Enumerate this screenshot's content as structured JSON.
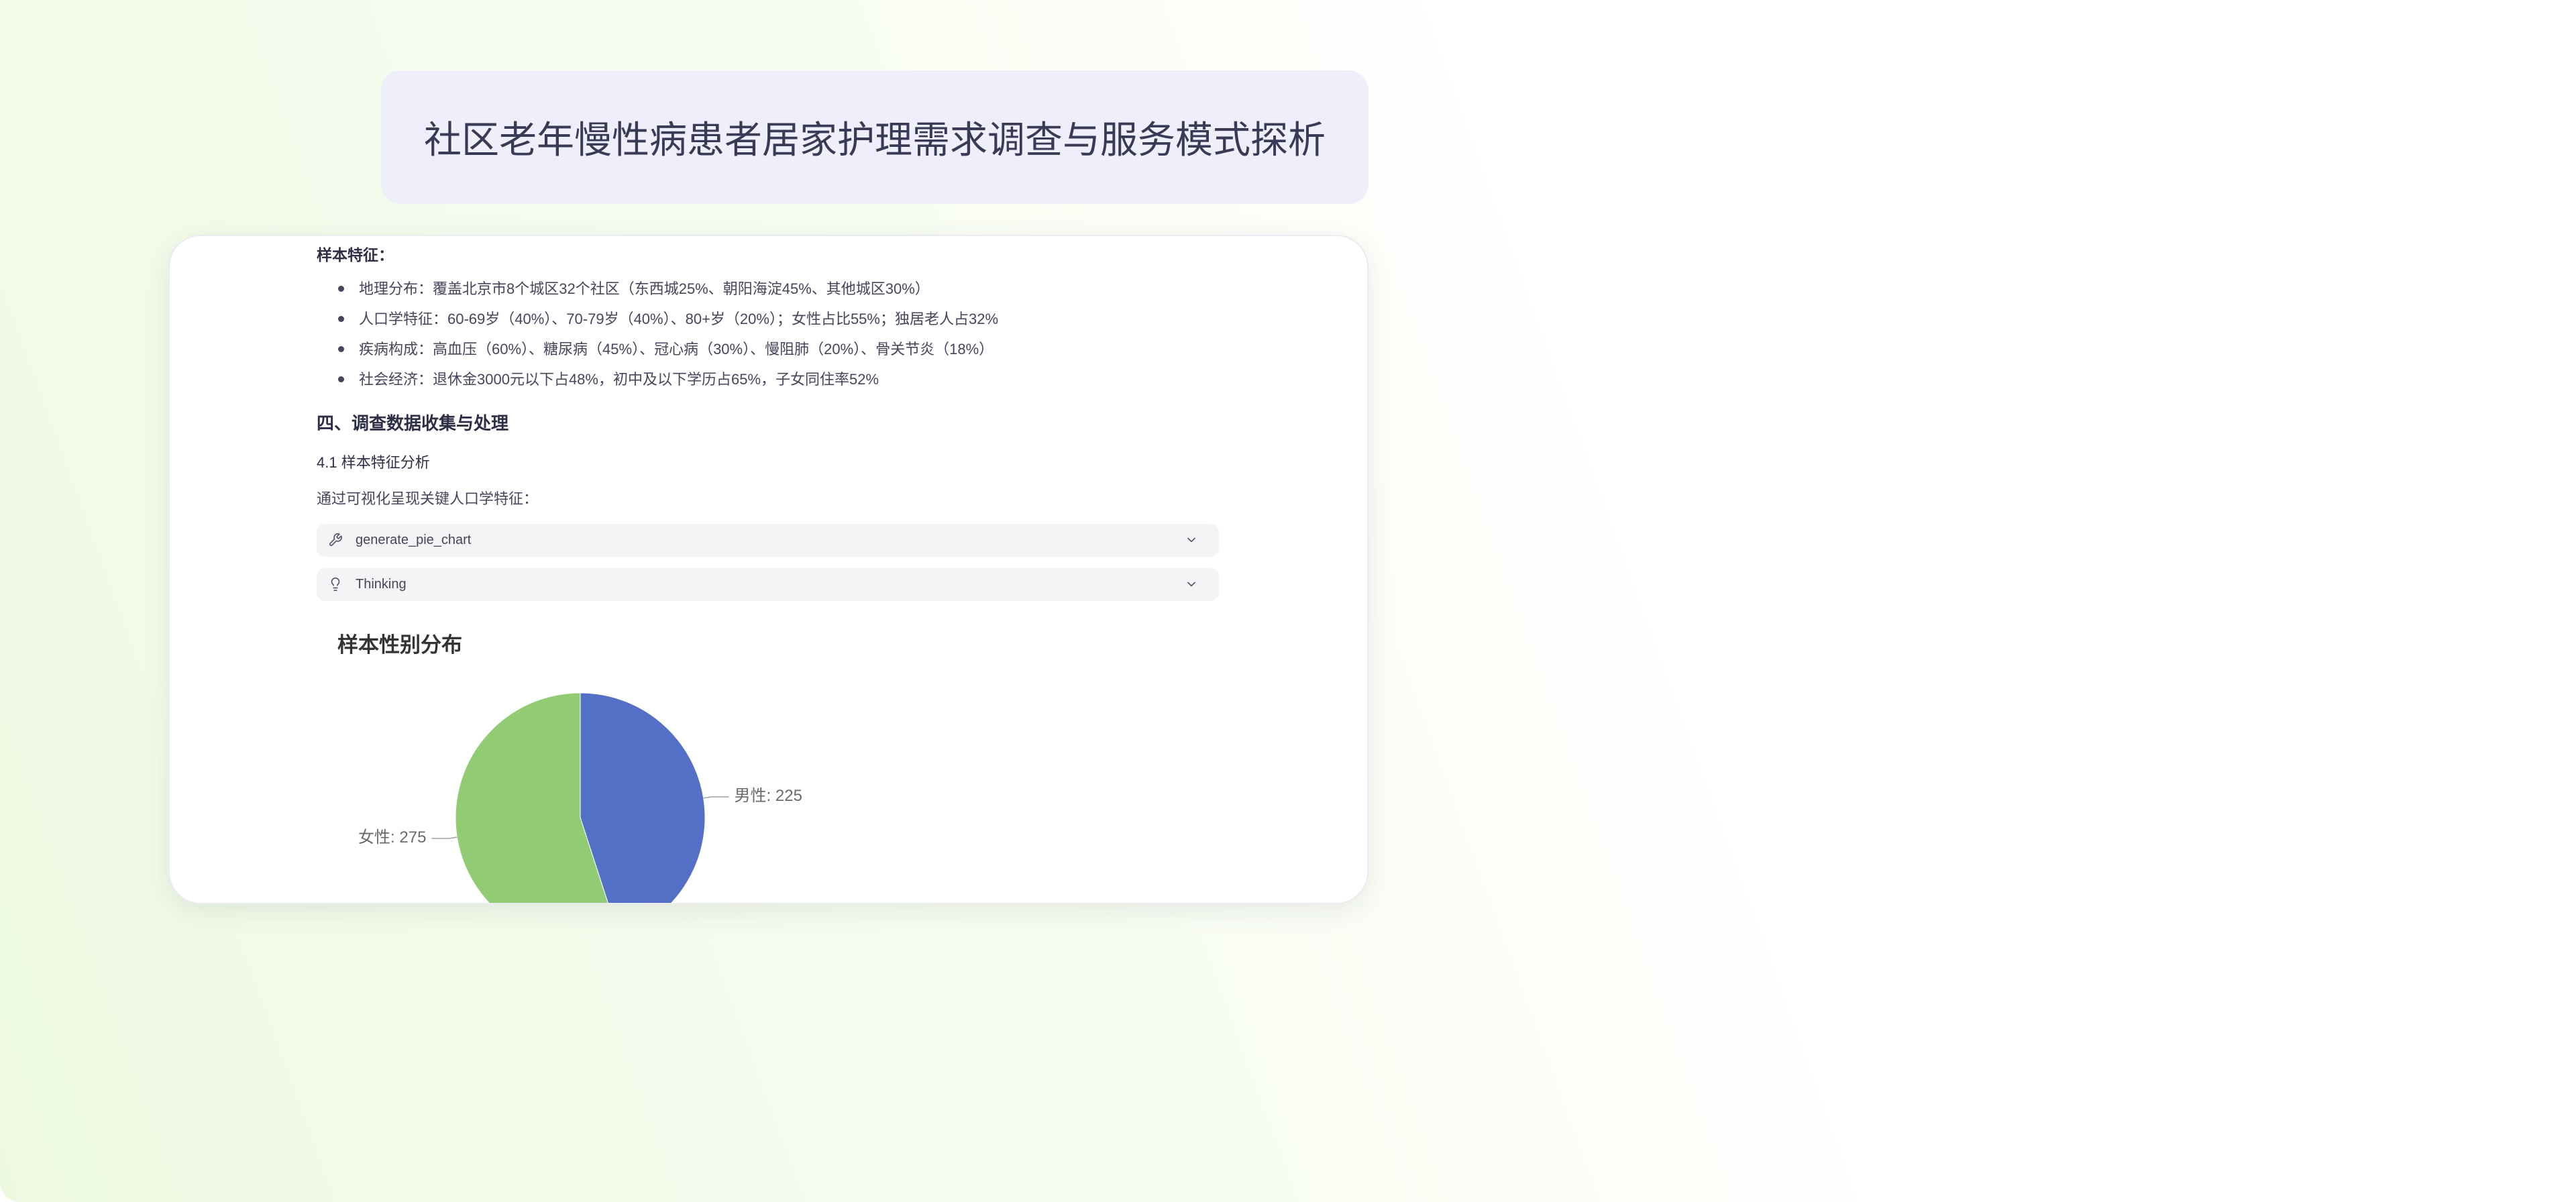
{
  "page": {
    "title": "社区老年慢性病患者居家护理需求调查与服务模式探析"
  },
  "document": {
    "sample_heading": "样本特征：",
    "sample_items": [
      "地理分布：覆盖北京市8个城区32个社区（东西城25%、朝阳海淀45%、其他城区30%）",
      "人口学特征：60-69岁（40%）、70-79岁（40%）、80+岁（20%）；女性占比55%；独居老人占32%",
      "疾病构成：高血压（60%）、糖尿病（45%）、冠心病（30%）、慢阻肺（20%）、骨关节炎（18%）",
      "社会经济：退休金3000元以下占48%，初中及以下学历占65%，子女同住率52%"
    ],
    "section_heading": "四、调查数据收集与处理",
    "subsection_heading": "4.1 样本特征分析",
    "intro_text": "通过可视化呈现关键人口学特征：",
    "tool_calls": [
      {
        "icon": "wrench-icon",
        "label": "generate_pie_chart",
        "toggle_icon": "chevron-down-icon"
      },
      {
        "icon": "lightbulb-icon",
        "label": "Thinking",
        "toggle_icon": "chevron-down-icon"
      }
    ]
  },
  "theme": {
    "title_card_background": "#efeefb",
    "background_accent": "#f2fae8"
  },
  "chart_data": {
    "type": "pie",
    "title": "样本性别分布",
    "categories": [
      "男性",
      "女性"
    ],
    "values": [
      225,
      275
    ],
    "colors": [
      "#5470c6",
      "#91cc75"
    ],
    "label_separator": ": "
  }
}
